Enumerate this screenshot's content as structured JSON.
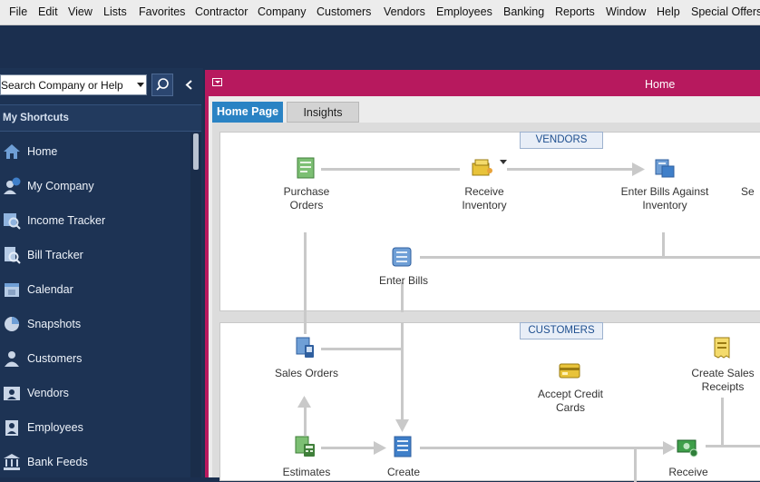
{
  "menubar": {
    "items": [
      "File",
      "Edit",
      "View",
      "Lists",
      "Favorites",
      "Contractor",
      "Company",
      "Customers",
      "Vendors",
      "Employees",
      "Banking",
      "Reports",
      "Window",
      "Help",
      "Special Offers"
    ]
  },
  "search": {
    "value": "Search Company or Help"
  },
  "sidebar": {
    "header": "My Shortcuts",
    "items": [
      {
        "label": "Home",
        "icon": "home-icon"
      },
      {
        "label": "My Company",
        "icon": "my-company-icon"
      },
      {
        "label": "Income Tracker",
        "icon": "income-tracker-icon"
      },
      {
        "label": "Bill Tracker",
        "icon": "bill-tracker-icon"
      },
      {
        "label": "Calendar",
        "icon": "calendar-icon"
      },
      {
        "label": "Snapshots",
        "icon": "pie-chart-icon"
      },
      {
        "label": "Customers",
        "icon": "person-icon"
      },
      {
        "label": "Vendors",
        "icon": "vendor-card-icon"
      },
      {
        "label": "Employees",
        "icon": "employee-icon"
      },
      {
        "label": "Bank Feeds",
        "icon": "bank-icon"
      }
    ]
  },
  "window": {
    "title": "Home",
    "tabs": [
      "Home Page",
      "Insights"
    ]
  },
  "vendors": {
    "header": "VENDORS",
    "purchase_orders": "Purchase Orders",
    "receive_inventory": "Receive Inventory",
    "enter_bills_against_inventory": "Enter Bills Against Inventory",
    "enter_bills": "Enter Bills",
    "partial_se": "Se"
  },
  "customers": {
    "header": "CUSTOMERS",
    "sales_orders": "Sales Orders",
    "accept_credit_cards": "Accept Credit Cards",
    "create_sales_receipts": "Create Sales Receipts",
    "estimates": "Estimates",
    "create": "Create",
    "receive": "Receive"
  },
  "colors": {
    "accent_magenta": "#b7195e",
    "sidebar_navy": "#1d3354",
    "tab_blue": "#2a83c4"
  }
}
